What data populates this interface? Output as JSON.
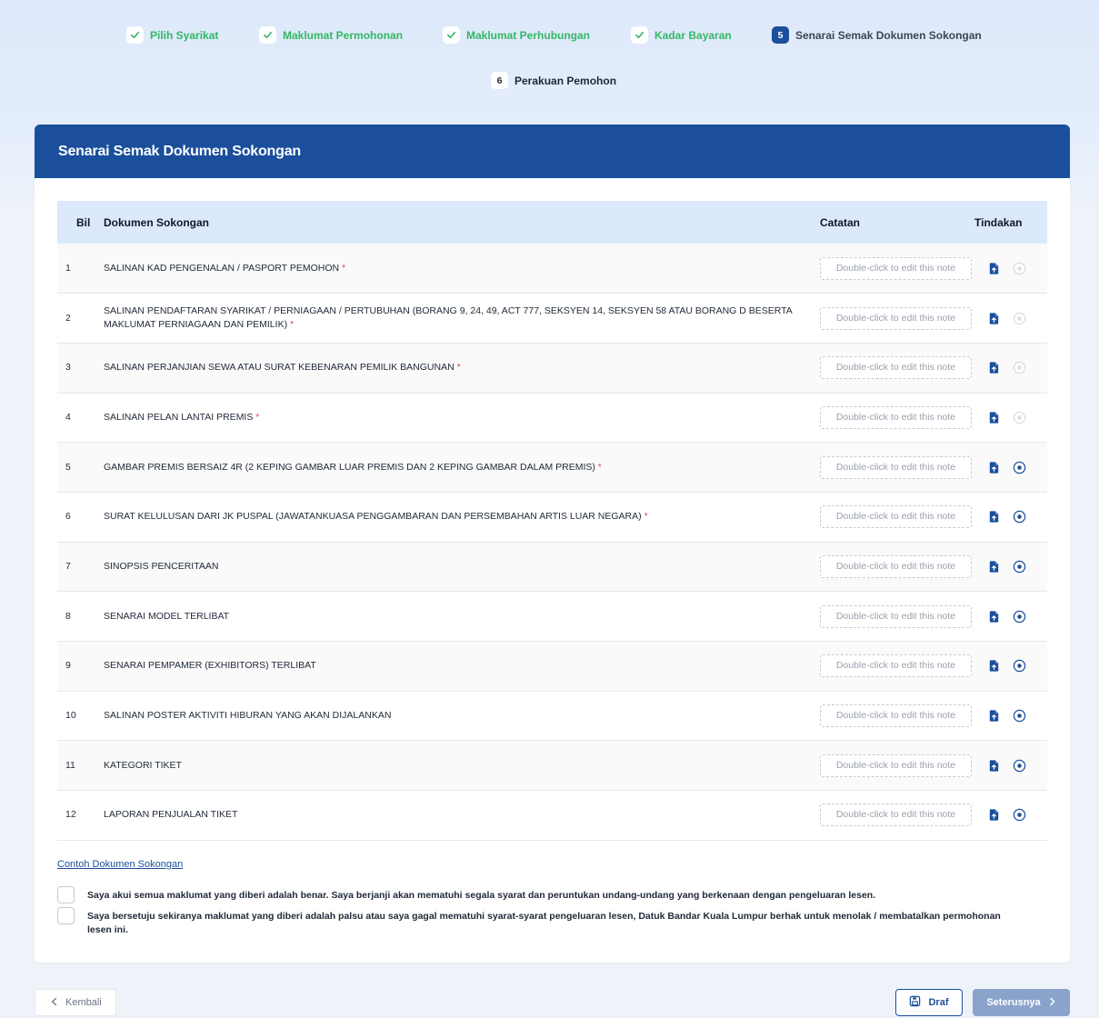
{
  "stepper": {
    "steps": [
      {
        "number": "",
        "label": "Pilih Syarikat",
        "state": "done"
      },
      {
        "number": "",
        "label": "Maklumat Permohonan",
        "state": "done"
      },
      {
        "number": "",
        "label": "Maklumat Perhubungan",
        "state": "done"
      },
      {
        "number": "",
        "label": "Kadar Bayaran",
        "state": "done"
      },
      {
        "number": "5",
        "label": "Senarai Semak Dokumen Sokongan",
        "state": "active"
      },
      {
        "number": "6",
        "label": "Perakuan Pemohon",
        "state": "pending"
      }
    ]
  },
  "card": {
    "title": "Senarai Semak Dokumen Sokongan"
  },
  "table": {
    "headers": {
      "no": "Bil",
      "doc": "Dokumen Sokongan",
      "note": "Catatan",
      "action": "Tindakan"
    },
    "note_placeholder": "Double-click to edit this note",
    "rows": [
      {
        "no": "1",
        "doc": "SALINAN KAD PENGENALAN / PASPORT PEMOHON",
        "required": "*",
        "view_enabled": false
      },
      {
        "no": "2",
        "doc": "SALINAN PENDAFTARAN SYARIKAT / PERNIAGAAN / PERTUBUHAN (BORANG 9, 24, 49, ACT 777, SEKSYEN 14, SEKSYEN 58 ATAU BORANG D BESERTA MAKLUMAT PERNIAGAAN DAN PEMILIK)",
        "required": "*",
        "view_enabled": false
      },
      {
        "no": "3",
        "doc": "SALINAN PERJANJIAN SEWA ATAU SURAT KEBENARAN PEMILIK BANGUNAN",
        "required": "*",
        "view_enabled": false
      },
      {
        "no": "4",
        "doc": "SALINAN PELAN LANTAI PREMIS",
        "required": "*",
        "view_enabled": false
      },
      {
        "no": "5",
        "doc": "GAMBAR PREMIS BERSAIZ 4R (2 KEPING GAMBAR LUAR PREMIS DAN 2 KEPING GAMBAR DALAM PREMIS)",
        "required": "*",
        "view_enabled": true
      },
      {
        "no": "6",
        "doc": "SURAT KELULUSAN DARI JK PUSPAL (JAWATANKUASA PENGGAMBARAN DAN PERSEMBAHAN ARTIS LUAR NEGARA)",
        "required": "*",
        "view_enabled": true
      },
      {
        "no": "7",
        "doc": "SINOPSIS PENCERITAAN",
        "required": "",
        "view_enabled": true
      },
      {
        "no": "8",
        "doc": "SENARAI MODEL TERLIBAT",
        "required": "",
        "view_enabled": true
      },
      {
        "no": "9",
        "doc": "SENARAI PEMPAMER (EXHIBITORS) TERLIBAT",
        "required": "",
        "view_enabled": true
      },
      {
        "no": "10",
        "doc": "SALINAN POSTER AKTIVITI HIBURAN YANG AKAN DIJALANKAN",
        "required": "",
        "view_enabled": true
      },
      {
        "no": "11",
        "doc": "KATEGORI TIKET",
        "required": "",
        "view_enabled": true
      },
      {
        "no": "12",
        "doc": "LAPORAN PENJUALAN TIKET",
        "required": "",
        "view_enabled": true
      }
    ]
  },
  "sample_link": "Contoh Dokumen Sokongan",
  "agreements": [
    "Saya akui semua maklumat yang diberi adalah benar. Saya berjanji akan mematuhi segala syarat dan peruntukan undang-undang yang berkenaan dengan pengeluaran lesen.",
    "Saya bersetuju sekiranya maklumat yang diberi adalah palsu atau saya gagal mematuhi syarat-syarat pengeluaran lesen, Datuk Bandar Kuala Lumpur berhak untuk menolak / membatalkan permohonan lesen ini."
  ],
  "footer": {
    "back_label": "Kembali",
    "draft_label": "Draf",
    "next_label": "Seterusnya"
  },
  "colors": {
    "primary": "#1b4f9c",
    "done_green": "#34b764",
    "required_red": "#e5484d",
    "next_disabled": "#8aa3cb"
  }
}
